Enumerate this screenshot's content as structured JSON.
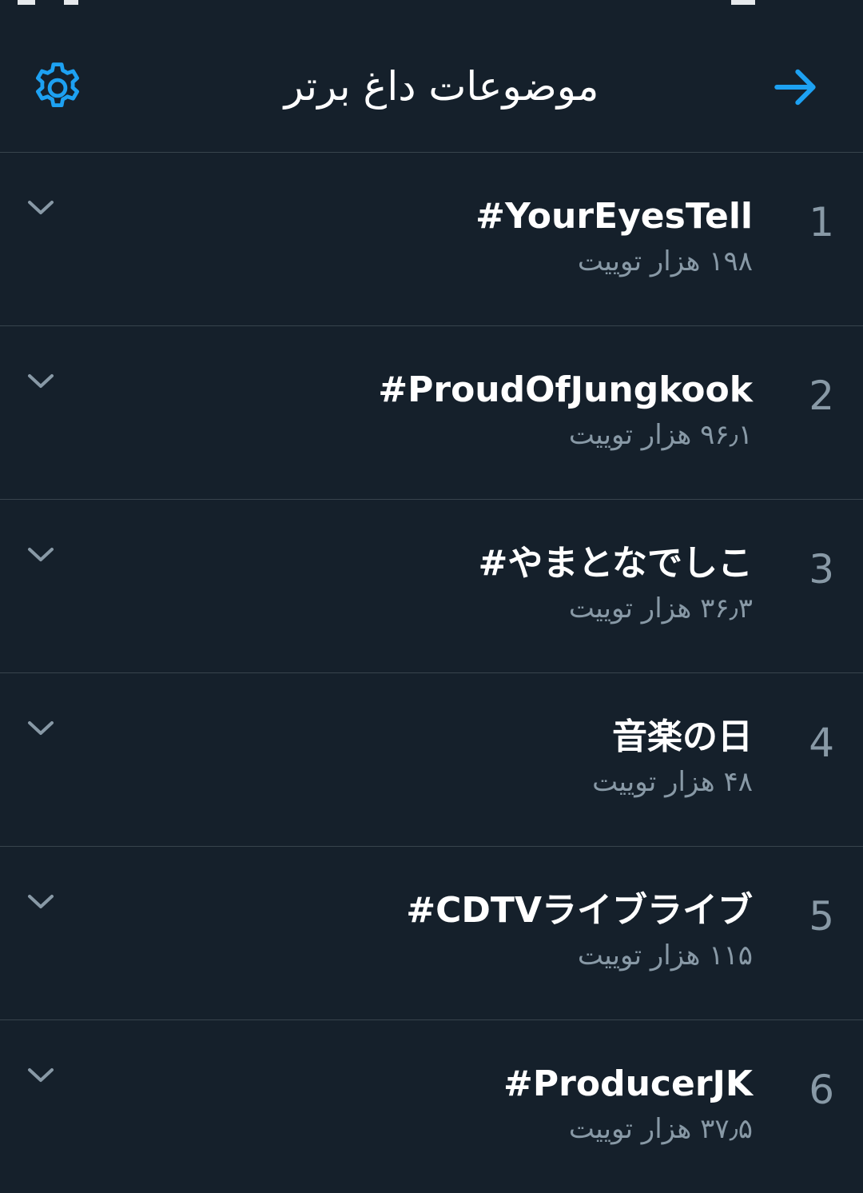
{
  "header": {
    "title": "موضوعات داغ برتر"
  },
  "icons": {
    "settings": "gear-icon",
    "back": "arrow-right-icon",
    "expand": "chevron-down-icon"
  },
  "colors": {
    "background": "#15202b",
    "accent": "#1da1f2",
    "divider": "#38444d",
    "secondary_text": "#8899a6",
    "primary_text": "#ffffff"
  },
  "trends": [
    {
      "rank": "1",
      "name": "#YourEyesTell",
      "count": "۱۹۸ هزار توییت"
    },
    {
      "rank": "2",
      "name": "#ProudOfJungkook",
      "count": "۹۶٫۱ هزار توییت"
    },
    {
      "rank": "3",
      "name": "#やまとなでしこ",
      "count": "۳۶٫۳ هزار توییت"
    },
    {
      "rank": "4",
      "name": "音楽の日",
      "count": "۴۸ هزار توییت"
    },
    {
      "rank": "5",
      "name": "#CDTVライブライブ",
      "count": "۱۱۵ هزار توییت"
    },
    {
      "rank": "6",
      "name": "#ProducerJK",
      "count": "۳۷٫۵ هزار توییت"
    }
  ]
}
